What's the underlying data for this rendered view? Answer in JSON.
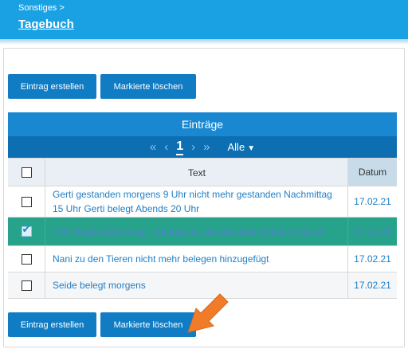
{
  "header": {
    "breadcrumb": "Sonstiges >",
    "title": "Tagebuch"
  },
  "toolbar_top": {
    "create_label": "Eintrag erstellen",
    "delete_label": "Markierte löschen"
  },
  "toolbar_bottom": {
    "create_label": "Eintrag erstellen",
    "delete_label": "Markierte löschen"
  },
  "panel": {
    "title": "Einträge",
    "pager": {
      "first": "«",
      "prev": "‹",
      "current_page": "1",
      "next": "›",
      "last": "»",
      "filter_label": "Alle"
    }
  },
  "table": {
    "columns": {
      "text": "Text",
      "date": "Datum"
    },
    "rows": [
      {
        "text": "Gerti gestanden morgens 9 Uhr nicht mehr gestanden Nachmittag 15 Uhr Gerti belegt Abends 20 Uhr",
        "date": "17.02.21",
        "checked": false
      },
      {
        "text": "Mein Tagebucheintrag - Eintrag nur am aktuellen Datum möglich",
        "date": "17.02.21",
        "checked": true
      },
      {
        "text": "Nani zu den Tieren nicht mehr belegen hinzugefügt",
        "date": "17.02.21",
        "checked": false
      },
      {
        "text": "Seide belegt morgens",
        "date": "17.02.21",
        "checked": false
      }
    ]
  },
  "icons": {
    "cursor": "orange-pointer-arrow-icon",
    "check": "checkmark-icon",
    "dropdown": "chevron-down-icon"
  },
  "colors": {
    "header": "#1aa1e4",
    "button": "#0f7cc4",
    "panel_head": "#1a88d1",
    "pager": "#0d6eb1",
    "selected_row": "#27a38b",
    "cursor": "#f07c2a"
  }
}
